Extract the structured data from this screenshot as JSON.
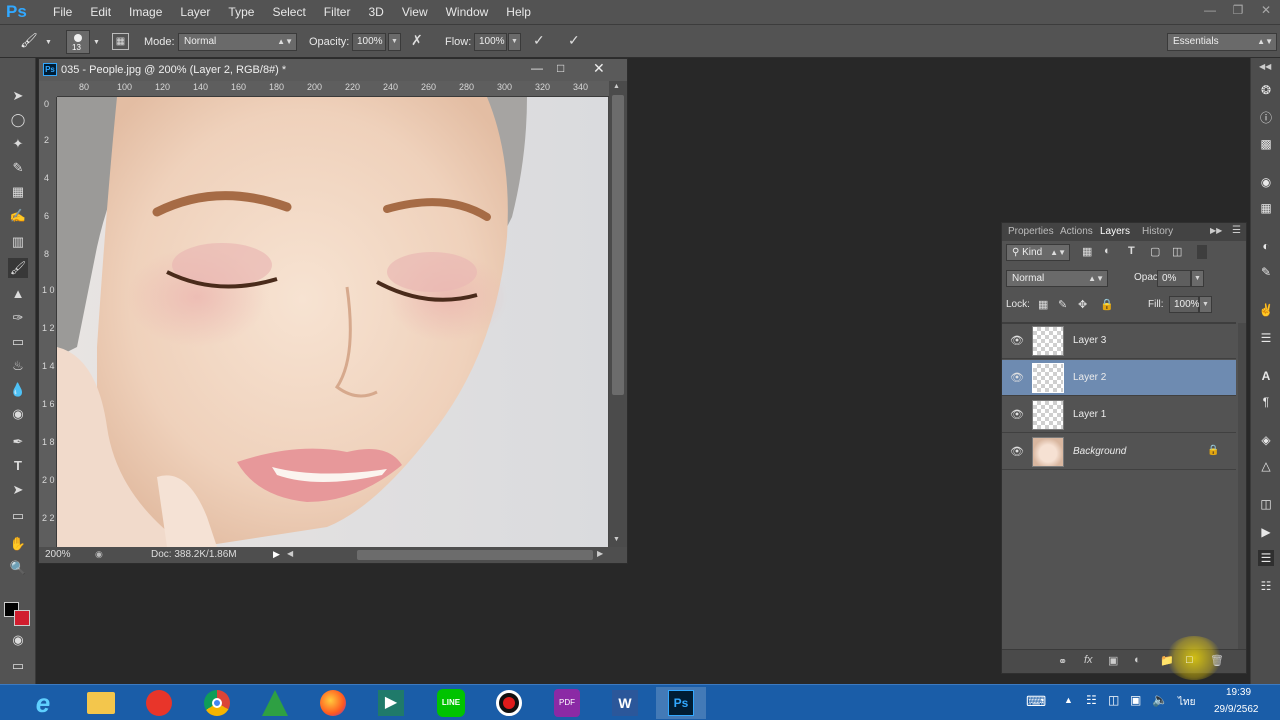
{
  "app": {
    "logo": "Ps",
    "menus": [
      "File",
      "Edit",
      "Image",
      "Layer",
      "Type",
      "Select",
      "Filter",
      "3D",
      "View",
      "Window",
      "Help"
    ]
  },
  "options": {
    "brush_size": "13",
    "mode_label": "Mode:",
    "mode_value": "Normal",
    "opacity_label": "Opacity:",
    "opacity_value": "100%",
    "flow_label": "Flow:",
    "flow_value": "100%",
    "workspace": "Essentials"
  },
  "document": {
    "title": "035 - People.jpg @ 200% (Layer 2, RGB/8#) *",
    "ruler_top": [
      "80",
      "100",
      "120",
      "140",
      "160",
      "180",
      "200",
      "220",
      "240",
      "260",
      "280",
      "300",
      "320",
      "340"
    ],
    "ruler_left": [
      "0",
      "2",
      "4",
      "6",
      "8",
      "1 0",
      "1 2",
      "1 4",
      "1 6",
      "1 8",
      "2 0",
      "2 2"
    ],
    "zoom": "200%",
    "doc_info": "Doc: 388.2K/1.86M"
  },
  "layers_panel": {
    "tabs": [
      "Properties",
      "Actions",
      "Layers",
      "History"
    ],
    "active_tab": "Layers",
    "filter_kind": "Kind",
    "blend_mode": "Normal",
    "opacity_label": "Opacity:",
    "opacity_value": "0%",
    "lock_label": "Lock:",
    "fill_label": "Fill:",
    "fill_value": "100%",
    "layers": [
      {
        "name": "Layer 3",
        "selected": false
      },
      {
        "name": "Layer 2",
        "selected": true
      },
      {
        "name": "Layer 1",
        "selected": false
      },
      {
        "name": "Background",
        "selected": false,
        "locked": true
      }
    ]
  },
  "taskbar": {
    "time": "19:39",
    "date": "29/9/2562",
    "lang": "ไทย",
    "apps": [
      "internet-explorer",
      "file-explorer",
      "app-red",
      "chrome",
      "app-green",
      "firefox",
      "app-teal",
      "line",
      "recorder",
      "pdf",
      "word",
      "photoshop"
    ]
  }
}
